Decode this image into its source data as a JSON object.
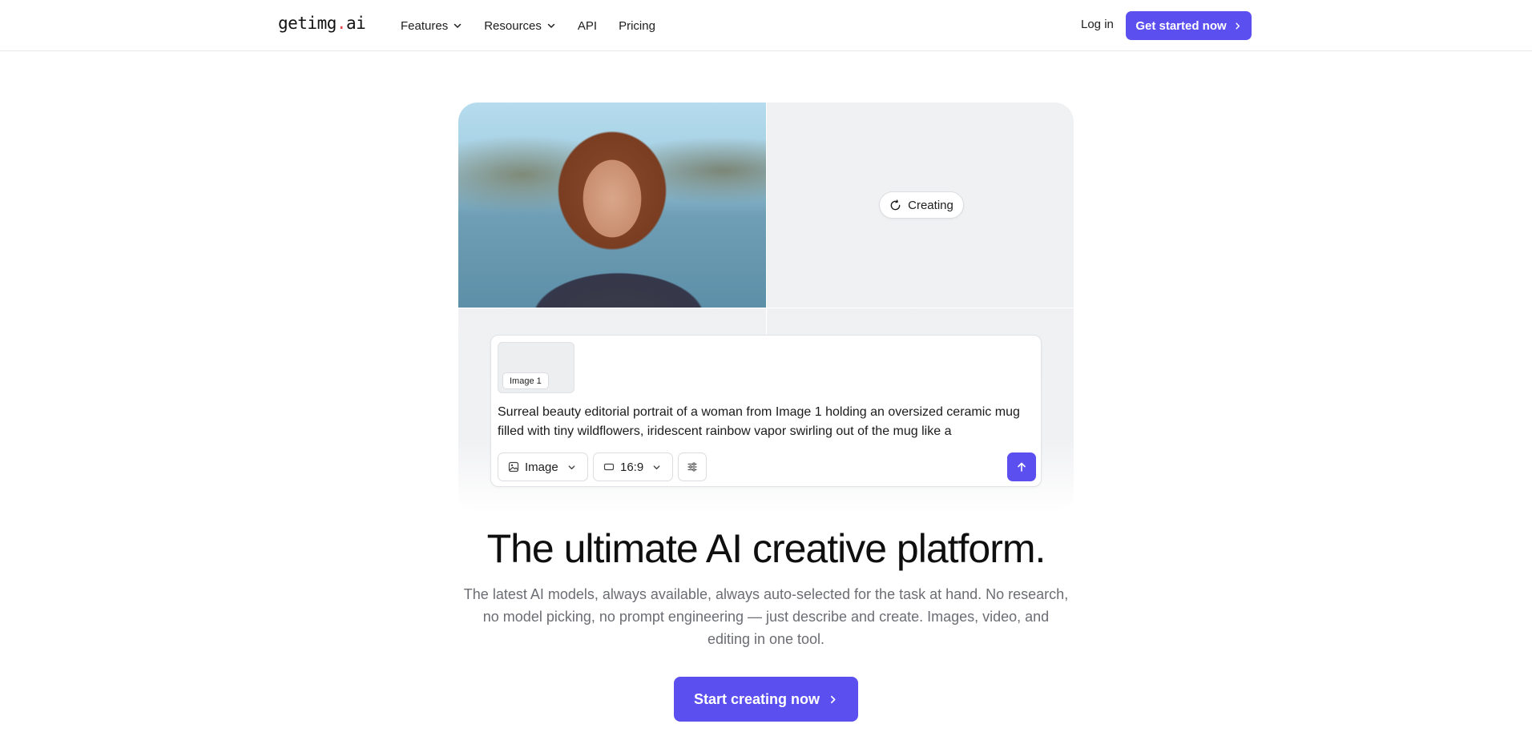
{
  "header": {
    "logo_part1": "getimg",
    "logo_dot": ".",
    "logo_part2": "ai",
    "nav": [
      {
        "label": "Features",
        "dropdown": true
      },
      {
        "label": "Resources",
        "dropdown": true
      },
      {
        "label": "API",
        "dropdown": false
      },
      {
        "label": "Pricing",
        "dropdown": false
      }
    ],
    "login_label": "Log in",
    "cta_label": "Get started now"
  },
  "hero_card": {
    "status_label": "Creating",
    "reference_image_label": "Image 1",
    "prompt_text": "Surreal beauty editorial portrait of a woman from Image 1 holding an oversized ceramic mug filled with tiny wildflowers, iridescent rainbow vapor swirling out of the mug like a",
    "mode_label": "Image",
    "ratio_label": "16:9"
  },
  "hero": {
    "headline": "The ultimate AI creative platform.",
    "subhead": "The latest AI models, always available, always auto-selected for the task at hand. No research, no model picking, no prompt engineering — just describe and create. Images, video, and editing in one tool.",
    "cta_label": "Start creating now"
  },
  "colors": {
    "accent": "#5b4ff0",
    "logo_dot": "#e5484d",
    "muted_text": "#6b6d73"
  },
  "icons": [
    "chevron-down-icon",
    "chevron-right-icon",
    "spinner-icon",
    "image-icon",
    "aspect-ratio-icon",
    "sliders-icon",
    "arrow-up-icon"
  ]
}
